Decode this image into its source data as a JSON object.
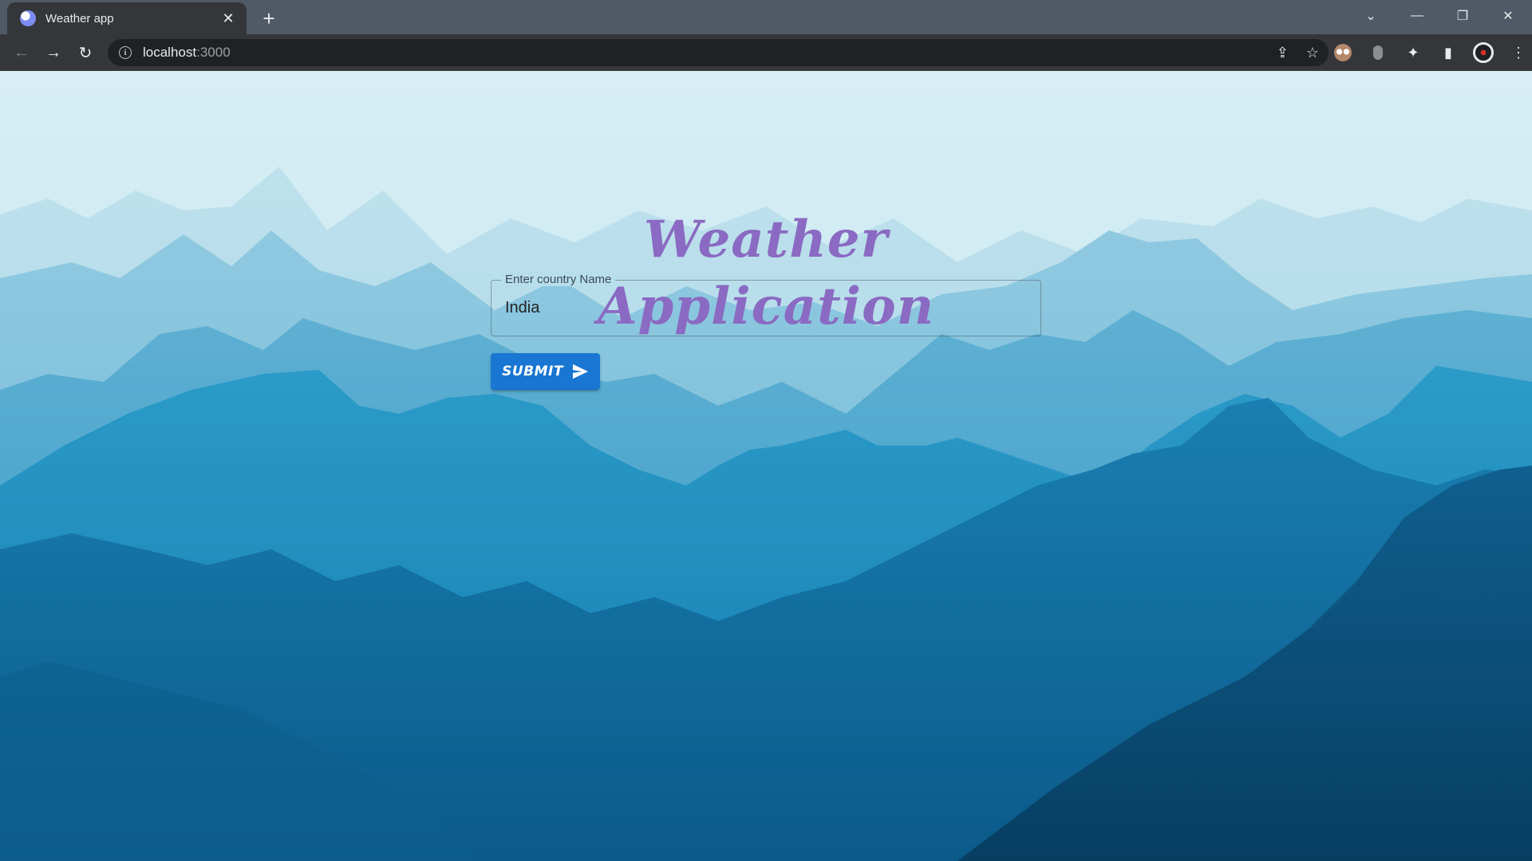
{
  "browser": {
    "tab_title": "Weather app",
    "tab_close": "✕",
    "new_tab": "+",
    "tab_search": "⌄",
    "minimize": "—",
    "restore": "❐",
    "close": "✕",
    "back": "←",
    "forward": "→",
    "reload": "↻",
    "url_host": "localhost",
    "url_port": ":3000",
    "share": "⇪",
    "bookmark": "☆",
    "extensions": "✦",
    "side_panel": "▮",
    "menu": "⋮"
  },
  "app": {
    "title": "Weather Application",
    "country_field": {
      "label": "Enter country Name",
      "value": "India"
    },
    "submit_label": "SUBMIT"
  },
  "colors": {
    "title": "#8a6ac2",
    "submit_button": "#1976d2",
    "tabstrip": "#505a66",
    "toolbar": "#35363a"
  }
}
